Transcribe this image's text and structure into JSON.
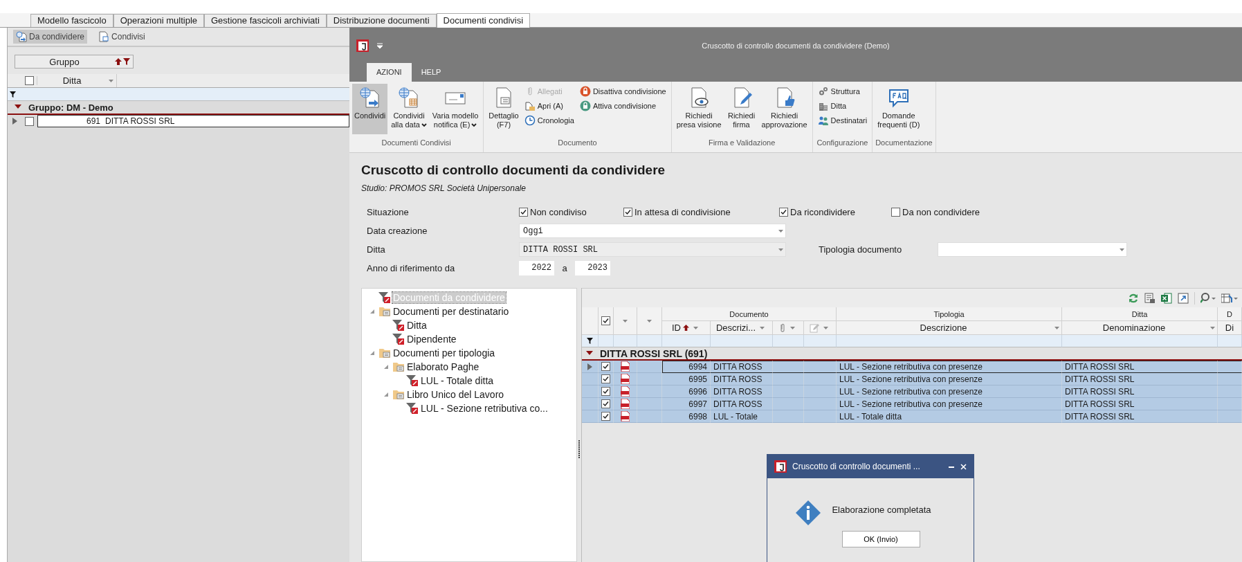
{
  "app_tabs": [
    {
      "label": "Modello fascicolo",
      "selected": false
    },
    {
      "label": "Operazioni multiple",
      "selected": false
    },
    {
      "label": "Gestione fascicoli archiviati",
      "selected": false
    },
    {
      "label": "Distribuzione documenti",
      "selected": false
    },
    {
      "label": "Documenti condivisi",
      "selected": true
    }
  ],
  "left_panel": {
    "toolbar": [
      {
        "label": "Da condividere",
        "selected": true
      },
      {
        "label": "Condivisi",
        "selected": false
      }
    ],
    "group_by": {
      "label": "Gruppo"
    },
    "grid": {
      "header_checked": false,
      "columns": [
        "Ditta"
      ],
      "group": {
        "label": "Gruppo: DM - Demo",
        "expanded": true
      },
      "rows": [
        {
          "code": "691",
          "name": "DITTA ROSSI SRL",
          "checked": false,
          "current": true
        }
      ]
    }
  },
  "window": {
    "title": "Cruscotto di controllo documenti da condividere  (Demo)",
    "ribbon_tabs": [
      {
        "label": "AZIONI",
        "selected": true
      },
      {
        "label": "HELP",
        "selected": false
      }
    ],
    "ribbon_groups": [
      {
        "label": "Documenti Condivisi",
        "items": [
          {
            "kind": "large",
            "lines": [
              "Condividi"
            ],
            "dropdown": false,
            "pressed": true
          },
          {
            "kind": "large",
            "lines": [
              "Condividi",
              "alla data"
            ],
            "dropdown": true,
            "pressed": false
          },
          {
            "kind": "large",
            "lines": [
              "Varia modello",
              "notifica (E)"
            ],
            "dropdown": true,
            "pressed": false
          }
        ]
      },
      {
        "label": "Documento",
        "items": [
          {
            "kind": "large",
            "lines": [
              "Dettaglio",
              "(F7)"
            ],
            "dropdown": false,
            "pressed": false
          },
          {
            "kind": "stack",
            "items": [
              {
                "label": "Allegati",
                "disabled": true
              },
              {
                "label": "Apri (A)",
                "disabled": false
              },
              {
                "label": "Cronologia",
                "disabled": false
              }
            ]
          },
          {
            "kind": "stack",
            "items": [
              {
                "label": "Disattiva condivisione",
                "disabled": false
              },
              {
                "label": "Attiva condivisione",
                "disabled": false
              }
            ]
          }
        ]
      },
      {
        "label": "Firma e Validazione",
        "items": [
          {
            "kind": "large",
            "lines": [
              "Richiedi",
              "presa visione"
            ],
            "dropdown": false,
            "pressed": false
          },
          {
            "kind": "large",
            "lines": [
              "Richiedi",
              "firma"
            ],
            "dropdown": false,
            "pressed": false
          },
          {
            "kind": "large",
            "lines": [
              "Richiedi",
              "approvazione"
            ],
            "dropdown": false,
            "pressed": false
          }
        ]
      },
      {
        "label": "Configurazione",
        "items": [
          {
            "kind": "stack",
            "items": [
              {
                "label": "Struttura",
                "disabled": false
              },
              {
                "label": "Ditta",
                "disabled": false
              },
              {
                "label": "Destinatari",
                "disabled": false
              }
            ]
          }
        ]
      },
      {
        "label": "Documentazione",
        "items": [
          {
            "kind": "large",
            "lines": [
              "Domande",
              "frequenti (D)"
            ],
            "dropdown": false,
            "pressed": false
          }
        ]
      }
    ]
  },
  "dashboard": {
    "title": "Cruscotto di controllo documenti da condividere",
    "subtitle": "Studio: PROMOS SRL Società Unipersonale",
    "situazione": {
      "label": "Situazione",
      "options": [
        {
          "label": "Non condiviso",
          "checked": true
        },
        {
          "label": "In attesa di condivisione",
          "checked": true
        },
        {
          "label": "Da ricondividere",
          "checked": true
        },
        {
          "label": "Da non condividere",
          "checked": false
        }
      ]
    },
    "data_creazione": {
      "label": "Data creazione",
      "value": "Oggi",
      "disabled": false
    },
    "ditta": {
      "label": "Ditta",
      "value": "DITTA ROSSI SRL",
      "disabled": true
    },
    "tipologia": {
      "label": "Tipologia documento",
      "disabled": false
    },
    "anno": {
      "label": "Anno di riferimento da",
      "from": "2022",
      "separator": "a",
      "to": "2023"
    }
  },
  "tree": [
    {
      "label": "Documenti da condividere",
      "kind": "filter",
      "selected": true
    },
    {
      "label": "Documenti per destinatario",
      "kind": "folder",
      "selected": false,
      "expanded": true,
      "children": [
        {
          "label": "Ditta",
          "kind": "filter",
          "selected": false
        },
        {
          "label": "Dipendente",
          "kind": "filter",
          "selected": false
        }
      ]
    },
    {
      "label": "Documenti per tipologia",
      "kind": "folder",
      "selected": false,
      "expanded": true,
      "children": [
        {
          "label": "Elaborato Paghe",
          "kind": "folder",
          "selected": false,
          "expanded": true,
          "children": [
            {
              "label": "LUL - Totale ditta",
              "kind": "filter",
              "selected": false
            }
          ]
        },
        {
          "label": "Libro Unico del Lavoro",
          "kind": "folder",
          "selected": false,
          "expanded": true,
          "children": [
            {
              "label": "LUL - Sezione retributiva co...",
              "kind": "filter",
              "selected": false
            }
          ]
        }
      ]
    }
  ],
  "grid": {
    "header_checked": true,
    "bands": [
      {
        "label": "Documento"
      },
      {
        "label": "Tipologia"
      },
      {
        "label": "Ditta"
      },
      {
        "label": "D"
      }
    ],
    "columns": [
      {
        "label": "ID",
        "sorted": true
      },
      {
        "label": "Descrizi...",
        "sorted": false
      },
      {
        "label": "Descrizione",
        "sorted": false
      },
      {
        "label": "Denominazione",
        "sorted": false
      },
      {
        "label": "Di",
        "sorted": false
      }
    ],
    "group": {
      "label": "DITTA ROSSI SRL (691)",
      "expanded": true
    },
    "rows": [
      {
        "id": "6994",
        "descrizione": "DITTA ROSS",
        "tipologia": "LUL - Sezione retributiva con presenze",
        "ditta": "DITTA ROSSI SRL",
        "checked": true,
        "selected": true,
        "current": true
      },
      {
        "id": "6995",
        "descrizione": "DITTA ROSS",
        "tipologia": "LUL - Sezione retributiva con presenze",
        "ditta": "DITTA ROSSI SRL",
        "checked": true,
        "selected": true,
        "current": false
      },
      {
        "id": "6996",
        "descrizione": "DITTA ROSS",
        "tipologia": "LUL - Sezione retributiva con presenze",
        "ditta": "DITTA ROSSI SRL",
        "checked": true,
        "selected": true,
        "current": false
      },
      {
        "id": "6997",
        "descrizione": "DITTA ROSS",
        "tipologia": "LUL - Sezione retributiva con presenze",
        "ditta": "DITTA ROSSI SRL",
        "checked": true,
        "selected": true,
        "current": false
      },
      {
        "id": "6998",
        "descrizione": "LUL - Totale",
        "tipologia": "LUL - Totale ditta",
        "ditta": "DITTA ROSSI SRL",
        "checked": true,
        "selected": true,
        "current": false
      }
    ]
  },
  "dialog": {
    "title": "Cruscotto di controllo documenti ...",
    "message": "Elaborazione completata",
    "button": "OK (Invio)"
  }
}
